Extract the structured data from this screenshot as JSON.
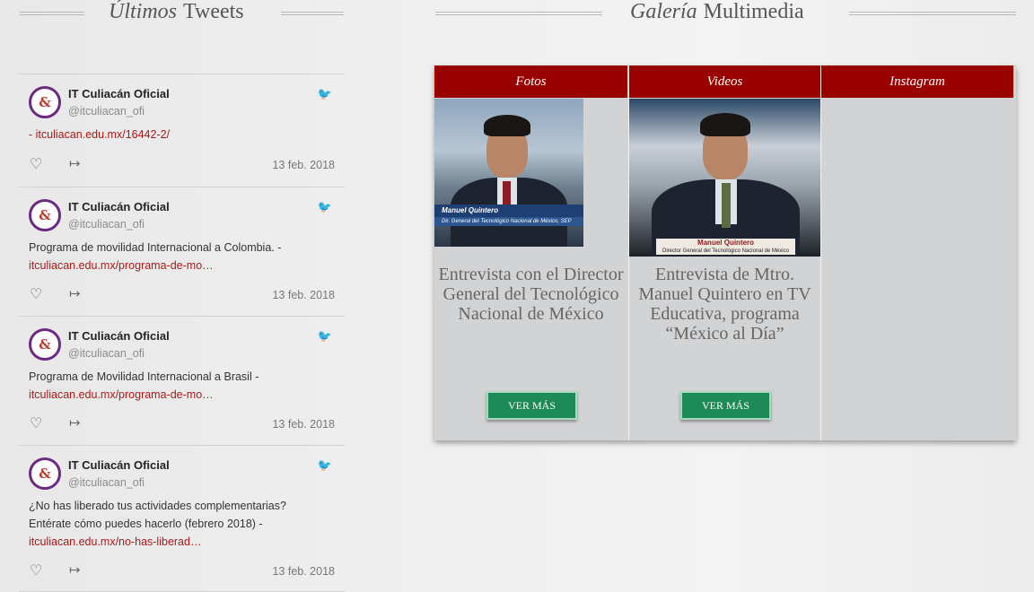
{
  "tweets_section": {
    "title_italic": "Últimos",
    "title_rest": "Tweets"
  },
  "gallery_section": {
    "title_italic": "Galería",
    "title_rest": "Multimedia"
  },
  "tweets": [
    {
      "name": "IT Culiacán Oficial",
      "handle": "@itculiacan_ofi",
      "text": "- ",
      "link": "itculiacan.edu.mx/16442-2/",
      "date": "13 feb. 2018"
    },
    {
      "name": "IT Culiacán Oficial",
      "handle": "@itculiacan_ofi",
      "text": "Programa de movilidad Internacional a Colombia. -",
      "link": "itculiacan.edu.mx/programa-de-mo…",
      "date": "13 feb. 2018"
    },
    {
      "name": "IT Culiacán Oficial",
      "handle": "@itculiacan_ofi",
      "text": "Programa de Movilidad Internacional a Brasil -",
      "link": "itculiacan.edu.mx/programa-de-mo…",
      "date": "13 feb. 2018"
    },
    {
      "name": "IT Culiacán Oficial",
      "handle": "@itculiacan_ofi",
      "text_line1": "¿No has liberado tus actividades complementarias?",
      "text": "Entérate cómo puedes hacerlo (febrero 2018) -",
      "link": "itculiacan.edu.mx/no-has-liberad…",
      "date": "13 feb. 2018"
    }
  ],
  "gallery": {
    "tabs": [
      "Fotos",
      "Videos",
      "Instagram"
    ],
    "items": [
      {
        "lower_third": "Manuel Quintero",
        "lower_third_sub": "Dir. General del Tecnológico Nacional de México, SEP",
        "caption": "Entrevista con el Director General del Tecnológico Nacional de México",
        "button": "VER MÁS"
      },
      {
        "lower_third": "Manuel Quintero",
        "lower_third_sub": "Director General del Tecnológico Nacional de México",
        "caption": "Entrevista de Mtro. Manuel Quintero en TV Educativa, programa “México al Día”",
        "button": "VER MÁS"
      }
    ]
  },
  "colors": {
    "tab_red": "#990000",
    "button_green": "#1e8a57",
    "link_red": "#b01818"
  }
}
